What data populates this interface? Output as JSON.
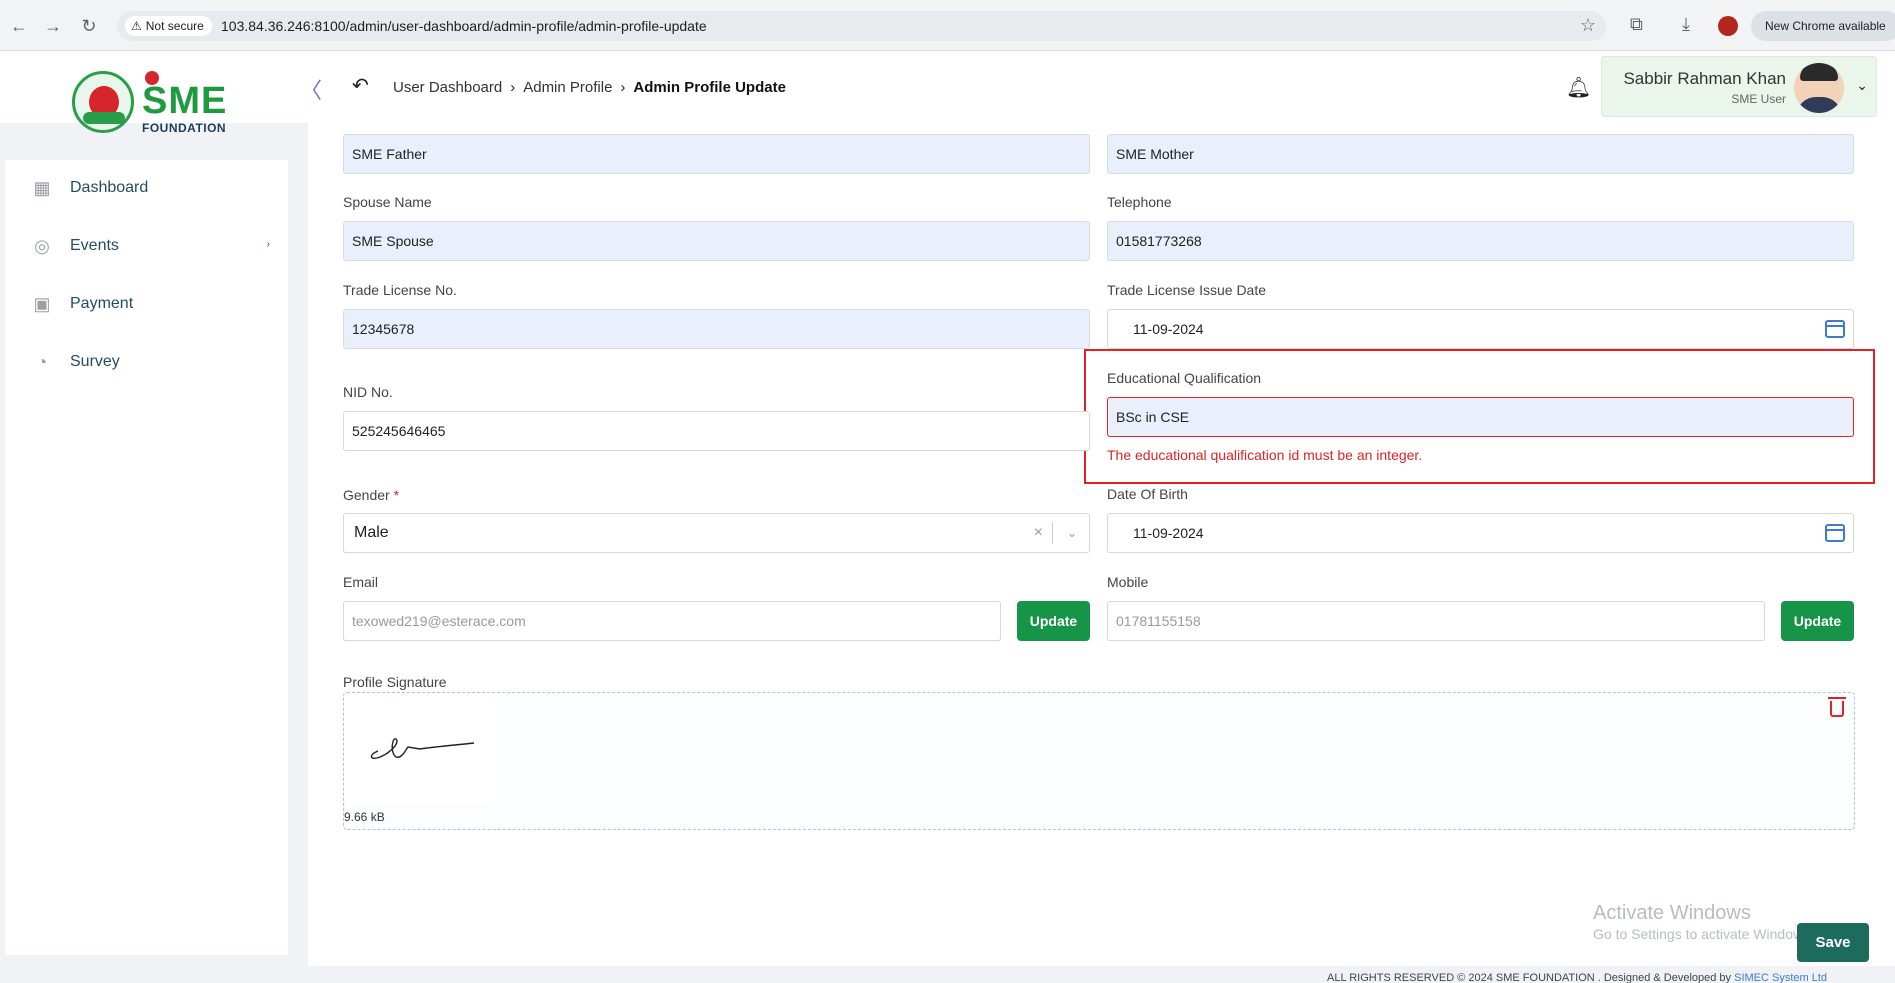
{
  "browser": {
    "not_secure": "Not secure",
    "url": "103.84.36.246:8100/admin/user-dashboard/admin-profile/admin-profile-update",
    "new_chrome": "New Chrome available"
  },
  "breadcrumb": {
    "item1": "User Dashboard",
    "item2": "Admin Profile",
    "current": "Admin Profile Update"
  },
  "logo": {
    "sme": "SME",
    "foundation": "FOUNDATION"
  },
  "user": {
    "name": "Sabbir Rahman Khan",
    "role": "SME User"
  },
  "sidebar": {
    "items": [
      {
        "label": "Dashboard",
        "icon": "grid-icon"
      },
      {
        "label": "Events",
        "icon": "events-icon"
      },
      {
        "label": "Payment",
        "icon": "payment-icon"
      },
      {
        "label": "Survey",
        "icon": "pie-chart-icon"
      }
    ]
  },
  "form": {
    "father_value": "SME Father",
    "mother_value": "SME Mother",
    "spouse_label": "Spouse Name",
    "spouse_value": "SME Spouse",
    "telephone_label": "Telephone",
    "telephone_value": "01581773268",
    "trade_license_label": "Trade License No.",
    "trade_license_value": "12345678",
    "trade_issue_label": "Trade License Issue Date",
    "trade_issue_value": "11-09-2024",
    "edu_label": "Educational Qualification",
    "edu_value": "BSc in CSE",
    "edu_error": "The educational qualification id must be an integer.",
    "nid_label": "NID No.",
    "nid_value": "525245646465",
    "gender_label": "Gender",
    "gender_required": "*",
    "gender_value": "Male",
    "dob_label": "Date Of Birth",
    "dob_value": "11-09-2024",
    "email_label": "Email",
    "email_value": "texowed219@esterace.com",
    "mobile_label": "Mobile",
    "mobile_value": "01781155158",
    "update_label": "Update",
    "signature_label": "Profile Signature",
    "signature_size": "9.66 kB",
    "save_label": "Save"
  },
  "watermark": {
    "line1": "Activate Windows",
    "line2": "Go to Settings to activate Windows."
  },
  "footer": {
    "text": "ALL RIGHTS RESERVED © 2024 SME FOUNDATION . Designed & Developed by",
    "link": "SIMEC System Ltd"
  },
  "colors": {
    "accent_green": "#169447",
    "error_red": "#e02424",
    "save_teal": "#1d6b5d"
  }
}
